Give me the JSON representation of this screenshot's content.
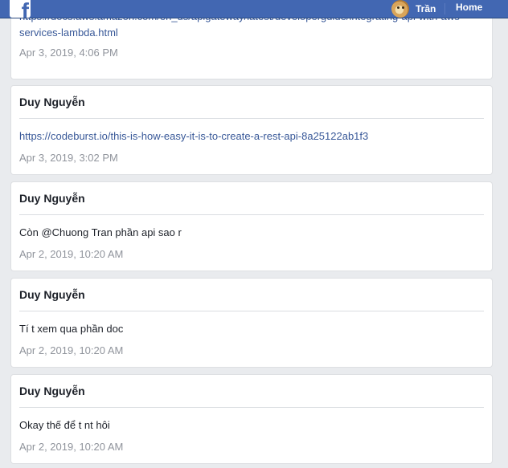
{
  "topbar": {
    "logo_letter": "f",
    "profile_name": "Trần",
    "home_label": "Home",
    "accent_color": "#4267b2"
  },
  "first_card": {
    "link_line1": "https://docs.aws.amazon.com/en_us/apigateway/latest/developerguide/integrating-api-with-aws-",
    "link_line2": "services-lambda.html",
    "timestamp": "Apr 3, 2019, 4:06 PM"
  },
  "posts": [
    {
      "author": "Duy Nguyễn",
      "message": "https://codeburst.io/this-is-how-easy-it-is-to-create-a-rest-api-8a25122ab1f3",
      "timestamp": "Apr 3, 2019, 3:02 PM"
    },
    {
      "author": "Duy Nguyễn",
      "message": "Còn @Chuong Tran phần api sao r",
      "timestamp": "Apr 2, 2019, 10:20 AM"
    },
    {
      "author": "Duy Nguyễn",
      "message": "Tí t xem qua phần doc",
      "timestamp": "Apr 2, 2019, 10:20 AM"
    },
    {
      "author": "Duy Nguyễn",
      "message": "Okay thế để t nt hôi",
      "timestamp": "Apr 2, 2019, 10:20 AM"
    }
  ]
}
